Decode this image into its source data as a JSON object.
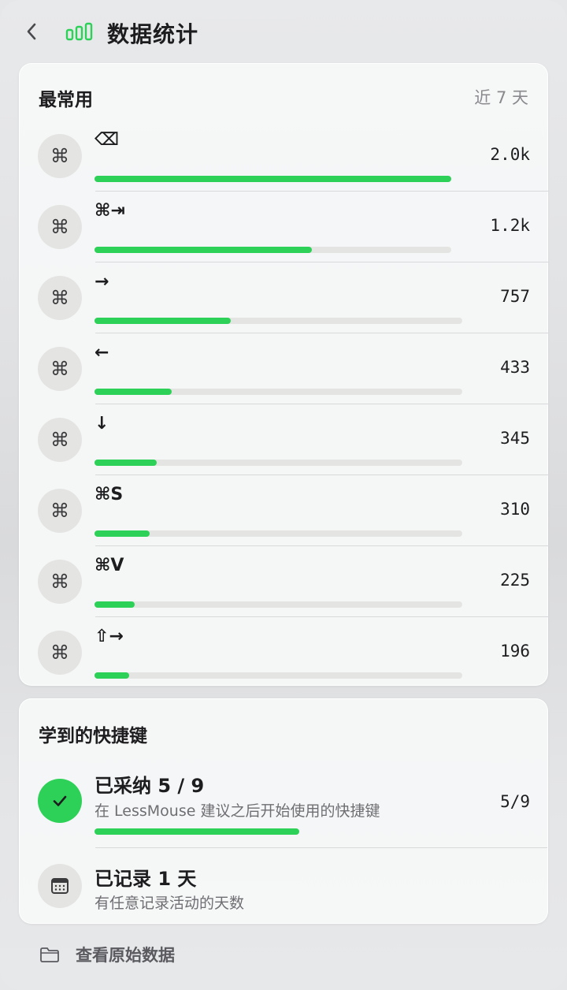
{
  "header": {
    "title": "数据统计",
    "accent_color": "#2ed158"
  },
  "usage": {
    "title": "最常用",
    "range": "近 7 天",
    "items": [
      {
        "keys": "⌫",
        "count": "2.0k",
        "value": 2000,
        "fraction": 0.97
      },
      {
        "keys": "⌘⇥",
        "count": "1.2k",
        "value": 1200,
        "fraction": 0.59
      },
      {
        "keys": "→",
        "count": "757",
        "value": 757,
        "fraction": 0.37
      },
      {
        "keys": "←",
        "count": "433",
        "value": 433,
        "fraction": 0.21
      },
      {
        "keys": "↓",
        "count": "345",
        "value": 345,
        "fraction": 0.17
      },
      {
        "keys": "⌘S",
        "count": "310",
        "value": 310,
        "fraction": 0.15
      },
      {
        "keys": "⌘V",
        "count": "225",
        "value": 225,
        "fraction": 0.11
      },
      {
        "keys": "⇧→",
        "count": "196",
        "value": 196,
        "fraction": 0.095
      }
    ],
    "item_icon": "command-icon",
    "command_glyph": "⌘"
  },
  "learned": {
    "title": "学到的快捷键",
    "adopted": {
      "title": "已采纳 5 / 9",
      "subtitle": "在 LessMouse 建议之后开始使用的快捷键",
      "count": "5/9",
      "progress": 0.556
    },
    "days": {
      "title": "已记录 1 天",
      "subtitle": "有任意记录活动的天数"
    }
  },
  "footer": {
    "label": "查看原始数据",
    "icon": "folder-icon"
  }
}
